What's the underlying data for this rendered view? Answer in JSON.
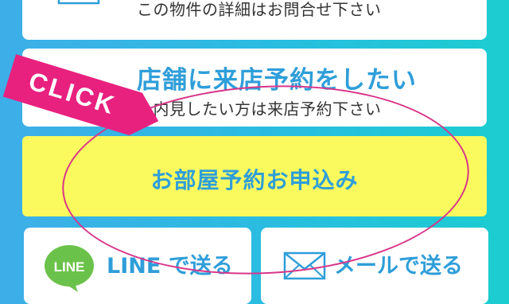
{
  "inquiry": {
    "subtitle": "この物件の詳細はお問合せ下さい",
    "icon": "mail-icon"
  },
  "visit": {
    "title": "店舗に来店予約をしたい",
    "subtitle": "を内見したい方は来店予約下さい"
  },
  "reserve": {
    "label": "お部屋予約お申込み",
    "background": "#fafa5e"
  },
  "share": {
    "line": {
      "badge": "LINE",
      "label": "LINE で送る",
      "icon": "line-icon"
    },
    "mail": {
      "label": "メールで送る",
      "icon": "mail-icon"
    }
  },
  "click_badge": {
    "label": "CLICK",
    "color": "#e8217f"
  },
  "colors": {
    "accent_text": "#2f9ed9",
    "highlight_ring": "#d8368a",
    "line_green": "#6bc24a"
  }
}
